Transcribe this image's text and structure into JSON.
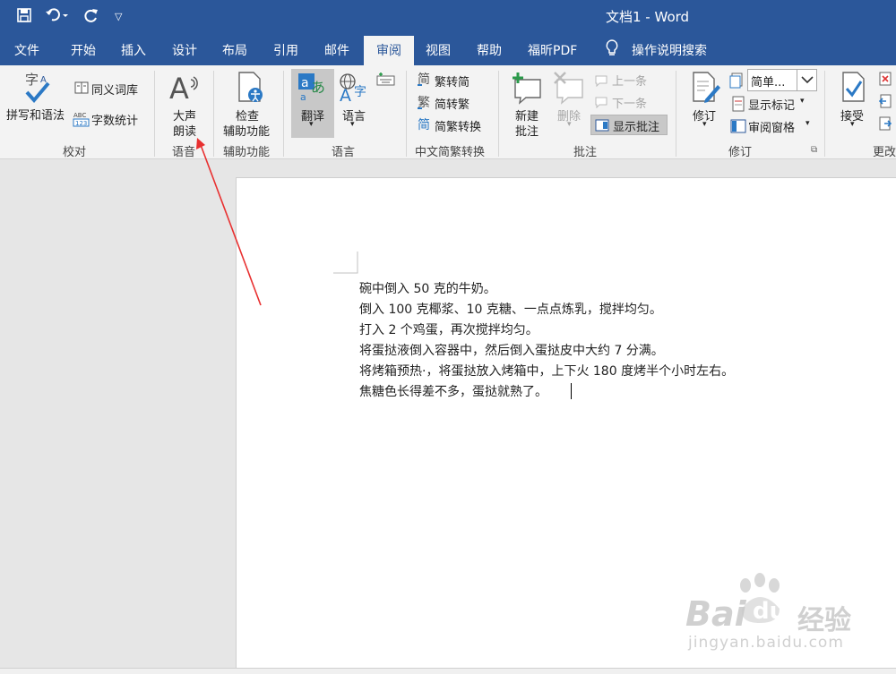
{
  "app": {
    "doc_title": "文档1  -  Word"
  },
  "tabs": [
    "文件",
    "开始",
    "插入",
    "设计",
    "布局",
    "引用",
    "邮件",
    "审阅",
    "视图",
    "帮助",
    "福昕PDF"
  ],
  "active_tab": "审阅",
  "search_label": "操作说明搜索",
  "ribbon": {
    "proofing": {
      "spell": "拼写和语法",
      "thesaurus": "同义词库",
      "wordcount": "字数统计",
      "label": "校对"
    },
    "speech": {
      "read_aloud_1": "大声",
      "read_aloud_2": "朗读",
      "label": "语音"
    },
    "accessibility": {
      "check_1": "检查",
      "check_2": "辅助功能",
      "label": "辅助功能"
    },
    "language": {
      "translate": "翻译",
      "language": "语言",
      "label": "语言"
    },
    "chinese": {
      "to_simplified": "繁转简",
      "to_traditional": "简转繁",
      "convert": "简繁转换",
      "label": "中文简繁转换"
    },
    "comments": {
      "new_1": "新建",
      "new_2": "批注",
      "delete": "删除",
      "prev": "上一条",
      "next": "下一条",
      "show": "显示批注",
      "label": "批注"
    },
    "tracking": {
      "track": "修订",
      "markup_select": "简单...",
      "show_markup": "显示标记",
      "reviewing_pane": "审阅窗格",
      "label": "修订"
    },
    "changes": {
      "accept": "接受",
      "label": "更改"
    }
  },
  "document": {
    "lines": [
      "碗中倒入 50 克的牛奶。",
      "倒入 100 克椰浆、10 克糖、一点点炼乳，搅拌均匀。",
      "打入 2 个鸡蛋，再次搅拌均匀。",
      "将蛋挞液倒入容器中，然后倒入蛋挞皮中大约 7 分满。",
      "将烤箱预热·，将蛋挞放入烤箱中，上下火 180 度烤半个小时左右。",
      "焦糖色长得差不多，蛋挞就熟了。"
    ]
  },
  "watermark": {
    "brand": "Bai",
    "du": "du",
    "jingyan": "经验",
    "url": "jingyan.baidu.com"
  },
  "colors": {
    "word_blue": "#2b579a",
    "annotation_red": "#e83030"
  }
}
